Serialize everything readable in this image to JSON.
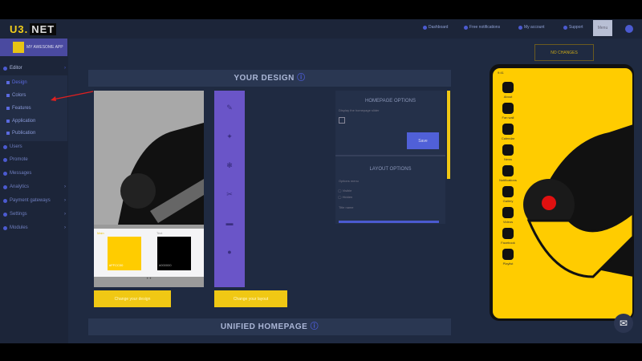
{
  "logo": {
    "text_a": "U3.",
    "text_b": "NET"
  },
  "topnav": [
    "Dashboard",
    "Free notifications",
    "My account",
    "Support"
  ],
  "topnav_button": "Menu",
  "account": "MY AWESOME APP",
  "sidebar": {
    "editor": "Editor",
    "editor_items": [
      "Design",
      "Colors",
      "Features",
      "Application",
      "Publication"
    ],
    "items": [
      "Users",
      "Promote",
      "Messages",
      "Analytics",
      "Payment gateways",
      "Settings",
      "Modules"
    ]
  },
  "main": {
    "your_design": "YOUR DESIGN",
    "palette": {
      "color1_label": "Main",
      "color1_value": "#FFCC00",
      "color2_label": "Text",
      "color2_value": "#000000"
    },
    "homepage_options": {
      "title": "HOMEPAGE OPTIONS",
      "label": "Display the homepage slider",
      "save": "Save"
    },
    "layout_options": {
      "title": "LAYOUT OPTIONS",
      "label": "Options menu",
      "radio1": "Visible",
      "radio2": "Hidden",
      "label2": "Title name"
    },
    "change_design": "Change your design",
    "change_layout": "Change your layout",
    "unified_homepage": "UNIFIED HOMEPAGE"
  },
  "preview": {
    "no_changes": "NO CHANGES",
    "status_time": "9:41",
    "icons": [
      "About",
      "Fan wall",
      "Calendar",
      "News",
      "Notifications",
      "Gallery",
      "Videos",
      "Facebook",
      "Playlist"
    ]
  },
  "colors": {
    "accent": "#4b5ad0",
    "yellow": "#f0c814",
    "purple": "#6a55c8",
    "bg": "#1f2a41"
  }
}
